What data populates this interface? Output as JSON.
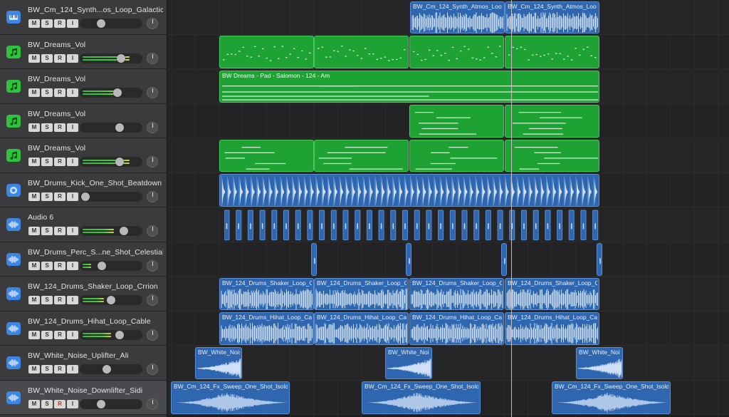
{
  "tracks": [
    {
      "name": "BW_Cm_124_Synth...os_Loop_Galactic",
      "icon": "synth-pad-icon",
      "type": "audio",
      "selected": false,
      "meter": 0,
      "vol": 0.3,
      "record_armed": false
    },
    {
      "name": "BW_Dreams_Vol",
      "icon": "music-note-icon",
      "type": "midi",
      "selected": false,
      "meter": 0.82,
      "vol": 0.7,
      "record_armed": false
    },
    {
      "name": "BW_Dreams_Vol",
      "icon": "music-note-icon",
      "type": "midi",
      "selected": false,
      "meter": 0.62,
      "vol": 0.62,
      "record_armed": false
    },
    {
      "name": "BW_Dreams_Vol",
      "icon": "music-note-icon",
      "type": "midi",
      "selected": false,
      "meter": 0,
      "vol": 0.66,
      "record_armed": false
    },
    {
      "name": "BW_Dreams_Vol",
      "icon": "music-note-icon",
      "type": "midi",
      "selected": false,
      "meter": 0.82,
      "vol": 0.66,
      "record_armed": false
    },
    {
      "name": "BW_Drums_Kick_One_Shot_Beatdown",
      "icon": "drum-kit-icon",
      "type": "audio",
      "selected": false,
      "meter": 0,
      "vol": 0,
      "record_armed": false
    },
    {
      "name": "Audio 6",
      "icon": "waveform-icon",
      "type": "audio",
      "selected": false,
      "meter": 0.55,
      "vol": 0.75,
      "record_armed": false
    },
    {
      "name": "BW_Drums_Perc_S...ne_Shot_Celestial",
      "icon": "waveform-icon",
      "type": "audio",
      "selected": false,
      "meter": 0.15,
      "vol": 0.32,
      "record_armed": false
    },
    {
      "name": "BW_124_Drums_Shaker_Loop_Crrion",
      "icon": "waveform-icon",
      "type": "audio",
      "selected": false,
      "meter": 0.38,
      "vol": 0.5,
      "record_armed": false
    },
    {
      "name": "BW_124_Drums_Hihat_Loop_Cable",
      "icon": "waveform-icon",
      "type": "audio",
      "selected": false,
      "meter": 0.5,
      "vol": 0.66,
      "record_armed": false
    },
    {
      "name": "BW_White_Noise_Uplifter_Ali",
      "icon": "waveform-icon",
      "type": "audio",
      "selected": false,
      "meter": 0,
      "vol": 0.42,
      "record_armed": false
    },
    {
      "name": "BW_White_Noise_Downlifter_Sidi",
      "icon": "waveform-icon",
      "type": "audio",
      "selected": true,
      "meter": 0,
      "vol": 0.3,
      "record_armed": true
    }
  ],
  "buttons": {
    "mute": "M",
    "solo": "S",
    "record": "R",
    "input": "I"
  },
  "regions": [
    {
      "track": 0,
      "name": "BW_Cm_124_Synth_Atmos_Loo",
      "kind": "audio",
      "wave": "dense"
    },
    {
      "track": 0,
      "name": "BW_Cm_124_Synth_Atmos_Loo",
      "kind": "audio",
      "wave": "dense"
    },
    {
      "track": 1,
      "name": "",
      "kind": "midi",
      "notes": "dots"
    },
    {
      "track": 1,
      "name": "",
      "kind": "midi",
      "notes": "dots"
    },
    {
      "track": 1,
      "name": "",
      "kind": "midi",
      "notes": "dots"
    },
    {
      "track": 1,
      "name": "",
      "kind": "midi",
      "notes": "dots"
    },
    {
      "track": 2,
      "name": "BW Dreams - Pad - Salomon - 124 - Am",
      "kind": "midi",
      "notes": "pad"
    },
    {
      "track": 3,
      "name": "",
      "kind": "midi",
      "notes": "lines"
    },
    {
      "track": 3,
      "name": "",
      "kind": "midi",
      "notes": "lines"
    },
    {
      "track": 4,
      "name": "",
      "kind": "midi",
      "notes": "lines"
    },
    {
      "track": 4,
      "name": "",
      "kind": "midi",
      "notes": "lines"
    },
    {
      "track": 4,
      "name": "",
      "kind": "midi",
      "notes": "lines"
    },
    {
      "track": 4,
      "name": "",
      "kind": "midi",
      "notes": "lines"
    },
    {
      "track": 5,
      "name": "",
      "kind": "audio",
      "wave": "kick"
    },
    {
      "track": 6,
      "name": "",
      "kind": "audio",
      "wave": "hits"
    },
    {
      "track": 7,
      "name": "",
      "kind": "audio",
      "wave": "perc"
    },
    {
      "track": 7,
      "name": "",
      "kind": "audio",
      "wave": "perc"
    },
    {
      "track": 7,
      "name": "",
      "kind": "audio",
      "wave": "perc"
    },
    {
      "track": 7,
      "name": "",
      "kind": "audio",
      "wave": "perc"
    },
    {
      "track": 8,
      "name": "BW_124_Drums_Shaker_Loop_C",
      "kind": "audio",
      "wave": "dense"
    },
    {
      "track": 8,
      "name": "BW_124_Drums_Shaker_Loop_C",
      "kind": "audio",
      "wave": "dense"
    },
    {
      "track": 8,
      "name": "BW_124_Drums_Shaker_Loop_C",
      "kind": "audio",
      "wave": "dense"
    },
    {
      "track": 8,
      "name": "BW_124_Drums_Shaker_Loop_C",
      "kind": "audio",
      "wave": "dense"
    },
    {
      "track": 9,
      "name": "BW_124_Drums_Hihat_Loop_Ca",
      "kind": "audio",
      "wave": "dense"
    },
    {
      "track": 9,
      "name": "BW_124_Drums_Hihat_Loop_Ca",
      "kind": "audio",
      "wave": "dense"
    },
    {
      "track": 9,
      "name": "BW_124_Drums_Hihat_Loop_Ca",
      "kind": "audio",
      "wave": "dense"
    },
    {
      "track": 9,
      "name": "BW_124_Drums_Hihat_Loop_Ca",
      "kind": "audio",
      "wave": "dense"
    },
    {
      "track": 10,
      "name": "BW_White_Nois",
      "kind": "audio",
      "wave": "rise"
    },
    {
      "track": 10,
      "name": "BW_White_Noi",
      "kind": "audio",
      "wave": "rise"
    },
    {
      "track": 10,
      "name": "BW_White_Noi",
      "kind": "audio",
      "wave": "rise"
    },
    {
      "track": 11,
      "name": "BW_Cm_124_Fx_Sweep_One_Shot_Isold",
      "kind": "audio",
      "wave": "fall"
    },
    {
      "track": 11,
      "name": "BW_Cm_124_Fx_Sweep_One_Shot_Isold",
      "kind": "audio",
      "wave": "fall"
    },
    {
      "track": 11,
      "name": "BW_Cm_124_Fx_Sweep_One_Shot_Isold",
      "kind": "audio",
      "wave": "fall"
    }
  ],
  "colors": {
    "audio": "#2f66b0",
    "midi": "#1fa234",
    "icon_audio": "#3d86e6",
    "icon_midi": "#2fc23f",
    "playhead": "#bfbfbf"
  }
}
